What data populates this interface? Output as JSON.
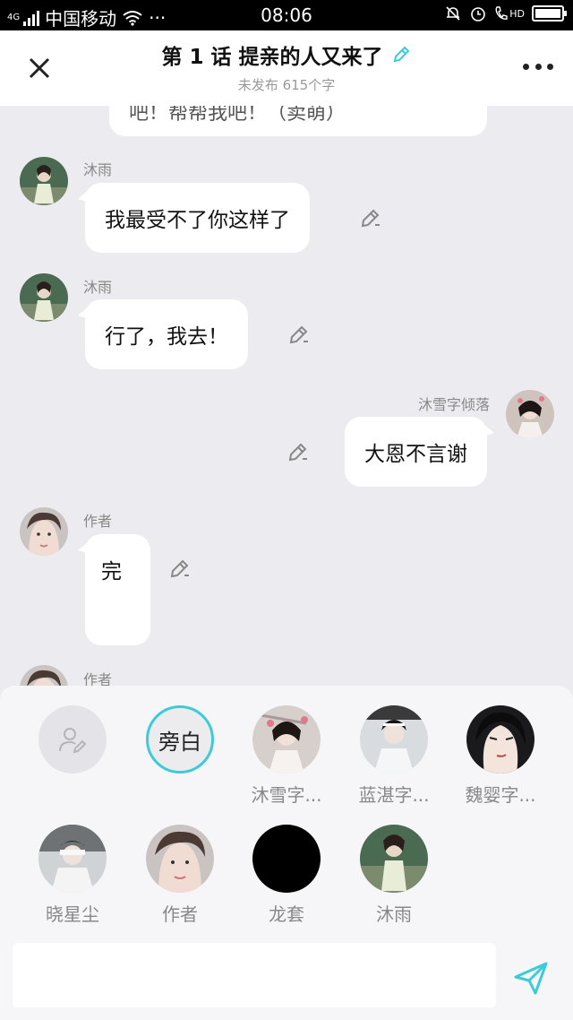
{
  "status_bar": {
    "network": "4G",
    "carrier": "中国移动",
    "dots": "···",
    "time": "08:06",
    "hd_label": "HD"
  },
  "header": {
    "title": "第 1 话 提亲的人又来了",
    "subtitle": "未发布 615个字",
    "accent_color": "#3ccbd8"
  },
  "chat": {
    "partial_message": "吧！帮帮我吧！（卖萌）",
    "messages": [
      {
        "sender": "沐雨",
        "text": "我最受不了你这样了",
        "side": "left",
        "avatar": "muyu-avatar"
      },
      {
        "sender": "沐雨",
        "text": "行了，我去！",
        "side": "left",
        "avatar": "muyu-avatar"
      },
      {
        "sender": "沐雪字倾落",
        "text": "大恩不言谢",
        "side": "right",
        "avatar": "muxue-avatar"
      },
      {
        "sender": "作者",
        "text": "完",
        "side": "left",
        "avatar": "author-avatar"
      },
      {
        "sender": "作者",
        "text": "",
        "side": "left",
        "avatar": "author-avatar"
      }
    ]
  },
  "roles": {
    "narrator_label": "旁白",
    "items": [
      {
        "label": "沐雪字..."
      },
      {
        "label": "蓝湛字..."
      },
      {
        "label": "魏婴字..."
      },
      {
        "label": "晓星尘"
      },
      {
        "label": "作者"
      },
      {
        "label": "龙套"
      },
      {
        "label": "沐雨"
      }
    ]
  },
  "composer": {
    "value": "",
    "placeholder": ""
  }
}
